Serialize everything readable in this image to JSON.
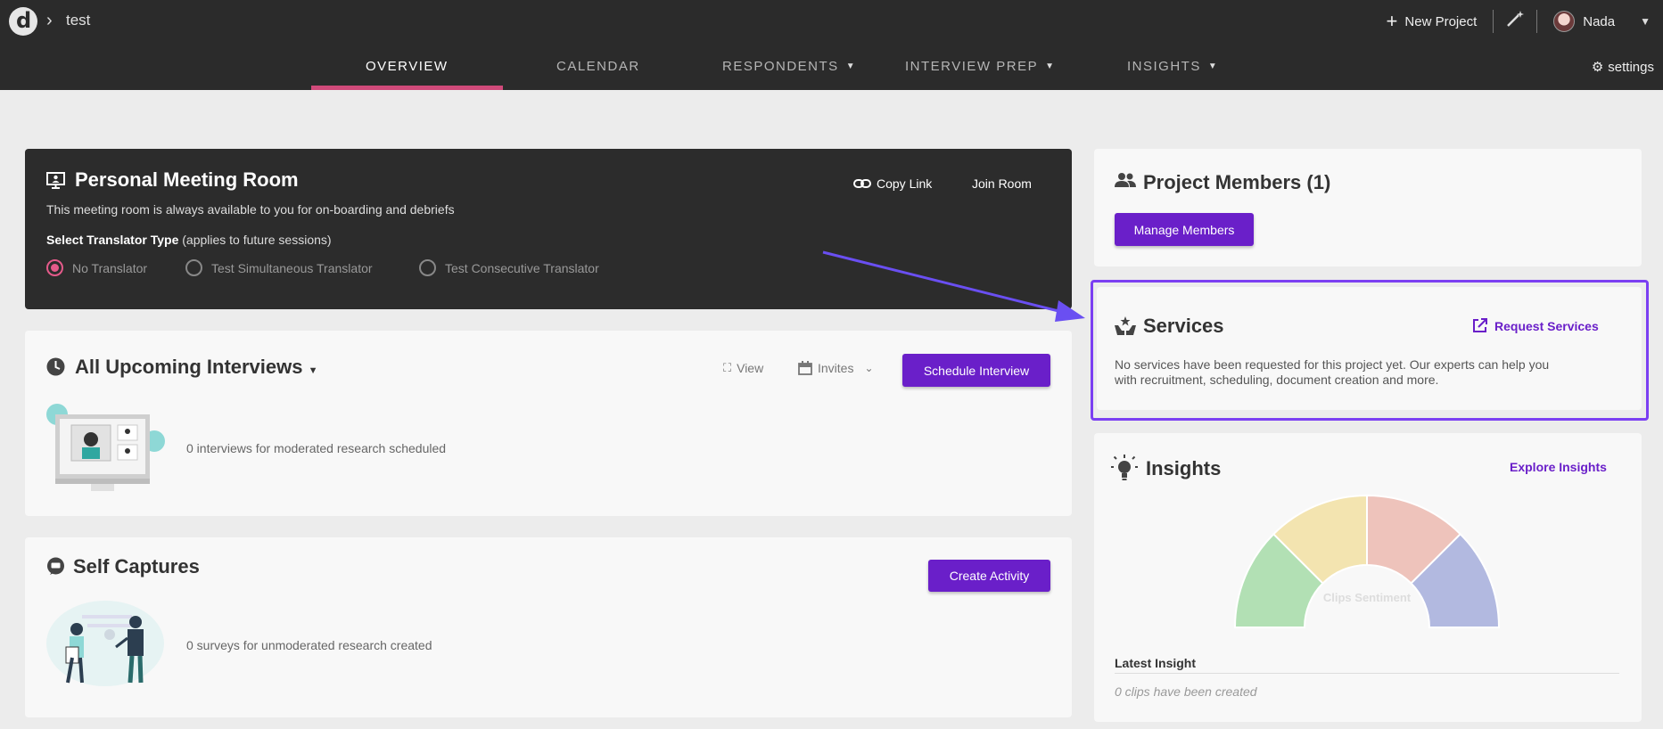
{
  "header": {
    "breadcrumb": "test",
    "new_project_label": "New Project",
    "user_name": "Nada",
    "settings_label": "settings"
  },
  "nav": {
    "tabs": [
      {
        "label": "OVERVIEW",
        "active": true
      },
      {
        "label": "CALENDAR",
        "active": false
      },
      {
        "label": "RESPONDENTS",
        "active": false,
        "has_caret": true
      },
      {
        "label": "INTERVIEW PREP",
        "active": false,
        "has_caret": true
      },
      {
        "label": "INSIGHTS",
        "active": false,
        "has_caret": true
      }
    ]
  },
  "meeting_room": {
    "title": "Personal Meeting Room",
    "description": "This meeting room is always available to you for on-boarding and debriefs",
    "translator_label": "Select Translator Type",
    "translator_hint": "(applies to future sessions)",
    "options": [
      {
        "label": "No Translator",
        "checked": true
      },
      {
        "label": "Test Simultaneous Translator",
        "checked": false
      },
      {
        "label": "Test Consecutive Translator",
        "checked": false
      }
    ],
    "copy_link_label": "Copy Link",
    "join_room_label": "Join Room"
  },
  "upcoming": {
    "title": "All Upcoming Interviews",
    "view_label": "View",
    "invites_label": "Invites",
    "schedule_label": "Schedule Interview",
    "empty_text": "0 interviews for moderated research scheduled"
  },
  "self_captures": {
    "title": "Self Captures",
    "create_label": "Create Activity",
    "empty_text": "0 surveys for unmoderated research created"
  },
  "members": {
    "title": "Project Members (1)",
    "manage_label": "Manage Members"
  },
  "services": {
    "title": "Services",
    "request_label": "Request Services",
    "description_line1": "No services have been requested for this project yet. Our experts can help you",
    "description_line2": "with recruitment, scheduling, document creation and more."
  },
  "insights": {
    "title": "Insights",
    "explore_label": "Explore Insights",
    "gauge_label": "Clips Sentiment",
    "latest_label": "Latest Insight",
    "empty_text": "0 clips have been created"
  },
  "colors": {
    "accent_purple": "#6a1fc9",
    "highlight_box": "#7b3ff2",
    "nav_underline": "#d04a7a",
    "gauge_green": "#b2e0b4",
    "gauge_yellow": "#f3e4b0",
    "gauge_pink": "#eec3bb",
    "gauge_blue": "#b2b9e0"
  }
}
